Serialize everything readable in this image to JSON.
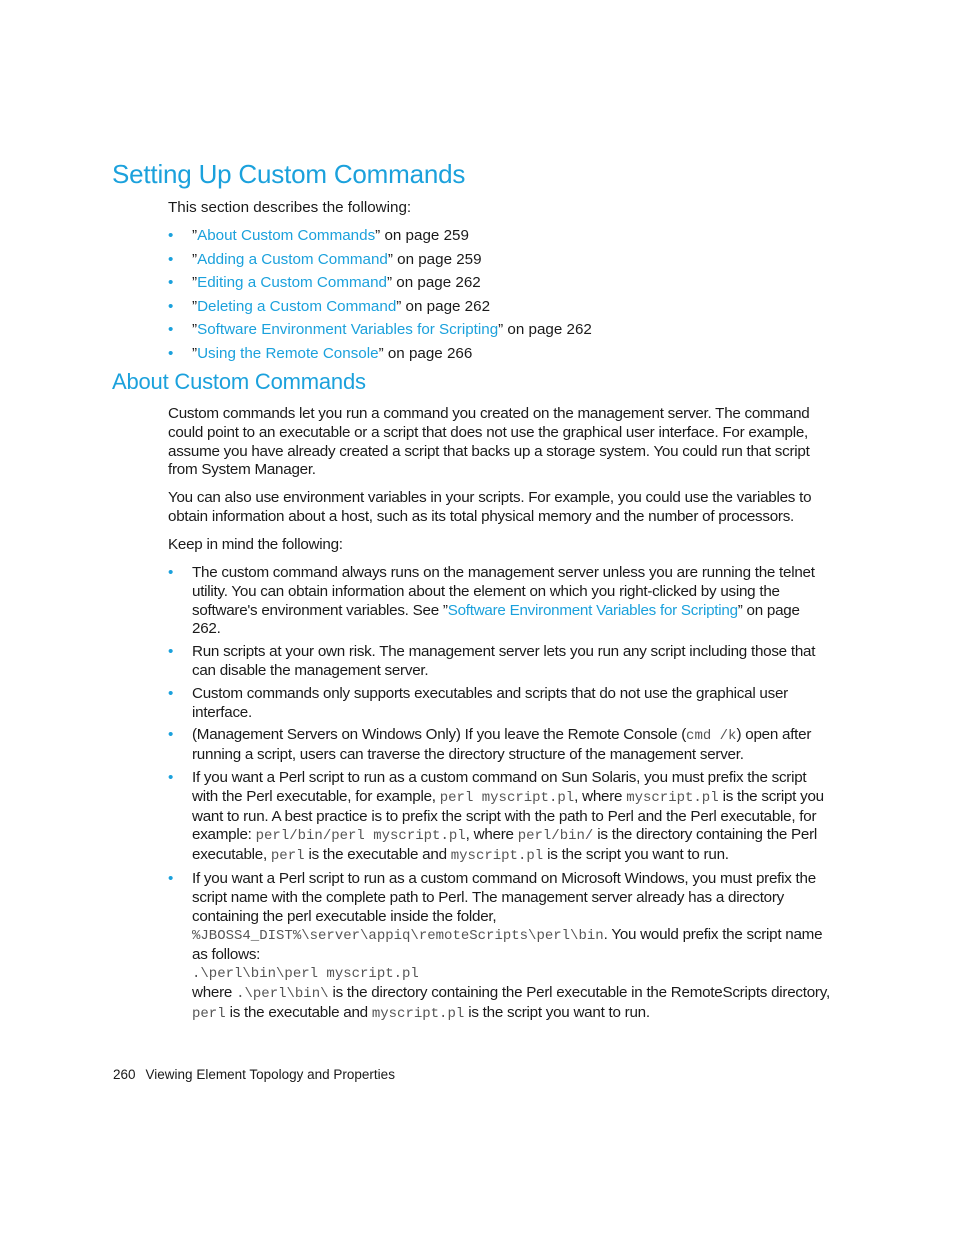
{
  "heading": "Setting Up Custom Commands",
  "intro": "This section describes the following:",
  "toc": [
    {
      "link": "About Custom Commands",
      "suffix": "” on page 259"
    },
    {
      "link": "Adding a Custom Command",
      "suffix": "” on page 259"
    },
    {
      "link": "Editing a Custom Command",
      "suffix": "” on page 262"
    },
    {
      "link": "Deleting a Custom Command",
      "suffix": "” on page 262"
    },
    {
      "link": "Software Environment Variables for Scripting",
      "suffix": "” on page 262"
    },
    {
      "link": "Using the Remote Console",
      "suffix": "” on page 266"
    }
  ],
  "open_quote": "”",
  "bullet": "•",
  "section": {
    "title": "About Custom Commands",
    "p1": "Custom commands let you run a command you created on the management server. The command could point to an executable or a script that does not use the graphical user interface. For example, assume you have already created a script that backs up a storage system. You could run that script from System Manager.",
    "p2": "You can also use environment variables in your scripts. For example, you could use the variables to obtain information about a host, such as its total physical memory and the number of processors.",
    "p3": "Keep in mind the following:",
    "notes": {
      "n1": {
        "t1": "The custom command always runs on the management server unless you are running the telnet utility. You can obtain information about the element on which you right-clicked by using the software's environment variables. See ”",
        "link": "Software Environment Variables for Scripting",
        "t2": "” on page 262."
      },
      "n2": "Run scripts at your own risk. The management server lets you run any script including those that can disable the management server.",
      "n3": "Custom commands only supports executables and scripts that do not use the graphical user interface.",
      "n4": {
        "t1": "(Management Servers on Windows Only) If you leave the Remote Console (",
        "c1": "cmd /k",
        "t2": ") open after running a script, users can traverse the directory structure of the management server."
      },
      "n5": {
        "t1": "If you want a Perl script to run as a custom command on Sun Solaris, you must prefix the script with the Perl executable, for example, ",
        "c1": "perl myscript.pl",
        "t2": ", where ",
        "c2": "myscript.pl",
        "t3": " is the script you want to run. A best practice is to prefix the script with the path to Perl and the Perl executable, for example: ",
        "c3": "perl/bin/perl myscript.pl",
        "t4": ", where ",
        "c4": "perl/bin/",
        "t5": " is the directory containing the Perl executable, ",
        "c5": "perl",
        "t6": "  is the executable and ",
        "c6": "myscript.pl",
        "t7": "  is the script you want to run."
      },
      "n6": {
        "t1": "If you want a Perl script to run as a custom command on Microsoft Windows, you must prefix the script name with the complete path to Perl. The management server already has a directory containing the perl executable inside the folder,",
        "c1": "%JBOSS4_DIST%\\server\\appiq\\remoteScripts\\perl\\bin",
        "t2": ". You would prefix the script name as follows:",
        "c2": ".\\perl\\bin\\perl myscript.pl",
        "t3": "where ",
        "c3": ".\\perl\\bin\\",
        "t4": " is the directory containing the Perl executable in the RemoteScripts directory, ",
        "c4": "perl",
        "t5": "  is the executable and ",
        "c5": "myscript.pl",
        "t6": "  is the script you want to run."
      }
    }
  },
  "footer": {
    "page": "260",
    "title": "Viewing Element Topology and Properties"
  }
}
